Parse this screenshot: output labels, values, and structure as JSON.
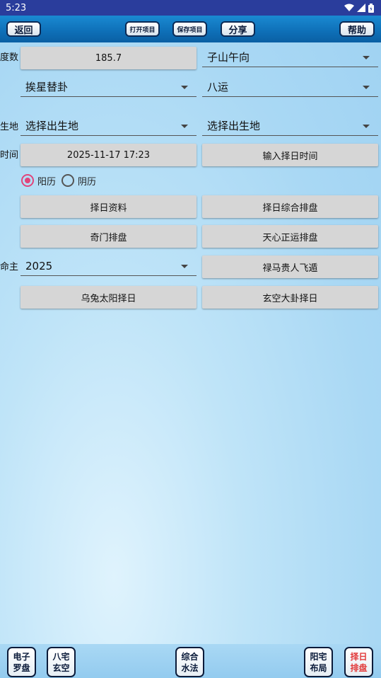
{
  "status": {
    "time": "5:23",
    "icons": [
      "wifi-icon",
      "signal-icon",
      "battery-icon"
    ]
  },
  "toolbar": {
    "back": "返回",
    "open_project": "打开项目",
    "save_project": "保存项目",
    "share": "分享",
    "help": "帮助"
  },
  "form": {
    "degree_label": "度数",
    "degree_value": "185.7",
    "direction_select": "子山午向",
    "method_select": "挨星替卦",
    "period_select": "八运",
    "birthplace_label": "生地",
    "birthplace_select_1": "选择出生地",
    "birthplace_select_2": "选择出生地",
    "time_label": "时间",
    "time_value": "2025-11-17 17:23",
    "input_date_button": "输入择日时间",
    "radio_solar": "阳历",
    "radio_lunar": "阴历",
    "selected_calendar": "阳历",
    "mingzhu_label": "命主",
    "mingzhu_select": "2025"
  },
  "actions": {
    "date_info": "择日资料",
    "date_combined_chart": "择日综合排盘",
    "qimen_chart": "奇门排盘",
    "tianxin_chart": "天心正运排盘",
    "luma_guiren": "禄马贵人飞遁",
    "wutu_sun": "乌兔太阳择日",
    "xuankong_dagua": "玄空大卦择日"
  },
  "bottom_nav": {
    "compass": [
      "电子",
      "罗盘"
    ],
    "bazhai": [
      "八宅",
      "玄空"
    ],
    "water": [
      "综合",
      "水法"
    ],
    "yangzhai": [
      "阳宅",
      "布局"
    ],
    "zeri": [
      "择日",
      "排盘"
    ],
    "active_color": "#e23b3b"
  },
  "colors": {
    "statusbar": "#2a3d9c",
    "toolbar": "#0e6fb7",
    "radio_accent": "#e0457b",
    "button_gray": "#d6d6d6"
  }
}
